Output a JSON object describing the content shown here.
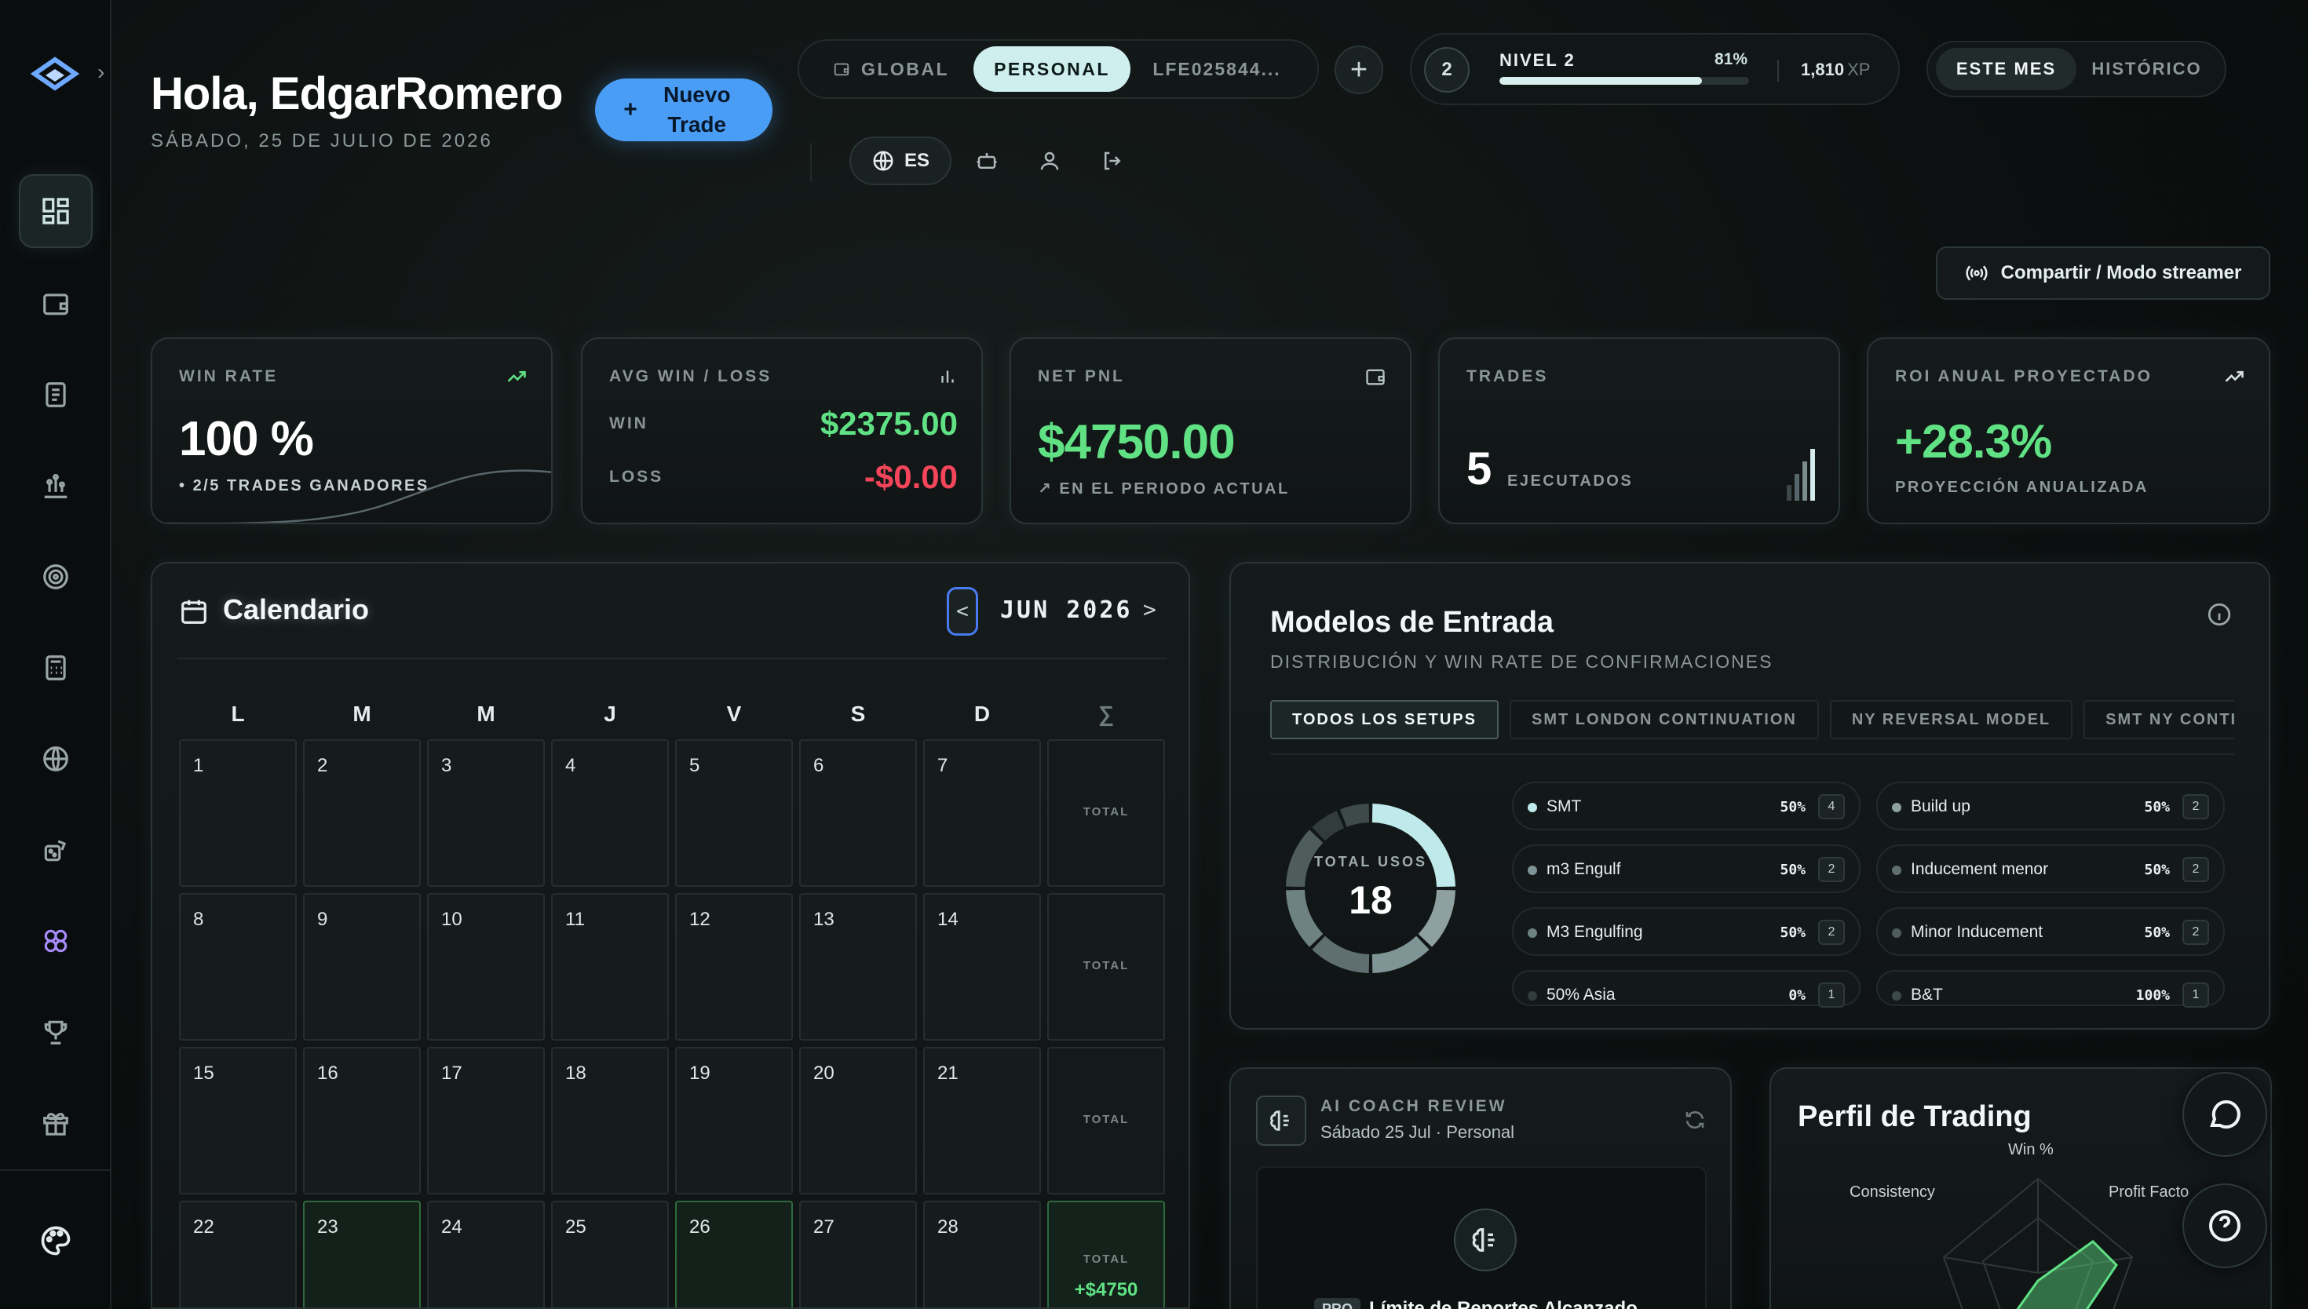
{
  "header": {
    "greeting": "Hola, EdgarRomero",
    "date": "SÁBADO, 25 DE JULIO DE 2026",
    "new_trade_label": "Nuevo Trade",
    "account_tabs": [
      {
        "label": "GLOBAL",
        "active": false
      },
      {
        "label": "PERSONAL",
        "active": true
      },
      {
        "label": "LFE025844...",
        "active": false
      }
    ],
    "level": {
      "number": "2",
      "name": "NIVEL 2",
      "progress_pct": "81%",
      "progress": 0.81,
      "xp": "1,810",
      "xp_unit": "XP"
    },
    "period_tabs": [
      {
        "label": "ESTE MES",
        "active": true
      },
      {
        "label": "HISTÓRICO",
        "active": false
      }
    ],
    "language": "ES",
    "share_label": "Compartir / Modo streamer"
  },
  "stats": {
    "win_rate": {
      "label": "WIN RATE",
      "value": "100",
      "unit": "%",
      "sub": "2/5 TRADES GANADORES"
    },
    "avg": {
      "label": "AVG WIN / LOSS",
      "win_label": "WIN",
      "win_value": "$2375.00",
      "loss_label": "LOSS",
      "loss_value": "-$0.00"
    },
    "pnl": {
      "label": "NET PNL",
      "value": "$4750.00",
      "sub": "EN EL PERIODO ACTUAL"
    },
    "trades": {
      "label": "TRADES",
      "value": "5",
      "sub": "EJECUTADOS"
    },
    "roi": {
      "label": "ROI ANUAL PROYECTADO",
      "value": "+28.3%",
      "sub": "PROYECCIÓN ANUALIZADA"
    }
  },
  "calendar": {
    "title": "Calendario",
    "month": "JUN 2026",
    "prev": "<",
    "next": ">",
    "dow": [
      "L",
      "M",
      "M",
      "J",
      "V",
      "S",
      "D",
      "∑"
    ],
    "weeks": [
      {
        "days": [
          "1",
          "2",
          "3",
          "4",
          "5",
          "6",
          "7"
        ],
        "total_label": "TOTAL",
        "total_value": "",
        "wins": []
      },
      {
        "days": [
          "8",
          "9",
          "10",
          "11",
          "12",
          "13",
          "14"
        ],
        "total_label": "TOTAL",
        "total_value": "",
        "wins": []
      },
      {
        "days": [
          "15",
          "16",
          "17",
          "18",
          "19",
          "20",
          "21"
        ],
        "total_label": "TOTAL",
        "total_value": "",
        "wins": []
      },
      {
        "days": [
          "22",
          "23",
          "24",
          "25",
          "26",
          "27",
          "28"
        ],
        "total_label": "TOTAL",
        "total_value": "+$4750",
        "wins": [
          1,
          4
        ]
      }
    ]
  },
  "models": {
    "title": "Modelos de Entrada",
    "subtitle": "DISTRIBUCIÓN Y WIN RATE DE CONFIRMACIONES",
    "tabs": [
      "TODOS LOS SETUPS",
      "SMT LONDON CONTINUATION",
      "NY REVERSAL MODEL",
      "SMT NY CONTINUATI"
    ],
    "total_label": "TOTAL USOS",
    "total_value": "18",
    "items": [
      {
        "name": "SMT",
        "pct": "50%",
        "count": "4",
        "color": "#bfe9ea"
      },
      {
        "name": "Build up",
        "pct": "50%",
        "count": "2",
        "color": "#8fa0a0"
      },
      {
        "name": "m3 Engulf",
        "pct": "50%",
        "count": "2",
        "color": "#7f9494"
      },
      {
        "name": "Inducement menor",
        "pct": "50%",
        "count": "2",
        "color": "#5f6e6e"
      },
      {
        "name": "M3 Engulfing",
        "pct": "50%",
        "count": "2",
        "color": "#6e8282"
      },
      {
        "name": "Minor Inducement",
        "pct": "50%",
        "count": "2",
        "color": "#4e5c5c"
      },
      {
        "name": "50% Asia",
        "pct": "0%",
        "count": "1",
        "color": "#323c3c"
      },
      {
        "name": "B&T",
        "pct": "100%",
        "count": "1",
        "color": "#3e4a4a"
      }
    ]
  },
  "coach": {
    "label": "AI COACH REVIEW",
    "date": "Sábado 25 Jul · Personal",
    "pro": "PRO",
    "limit": "Límite de Reportes Alcanzado"
  },
  "profile": {
    "title": "Perfil de Trading",
    "axes": [
      "Win %",
      "Consistency",
      "Profit Facto"
    ]
  }
}
